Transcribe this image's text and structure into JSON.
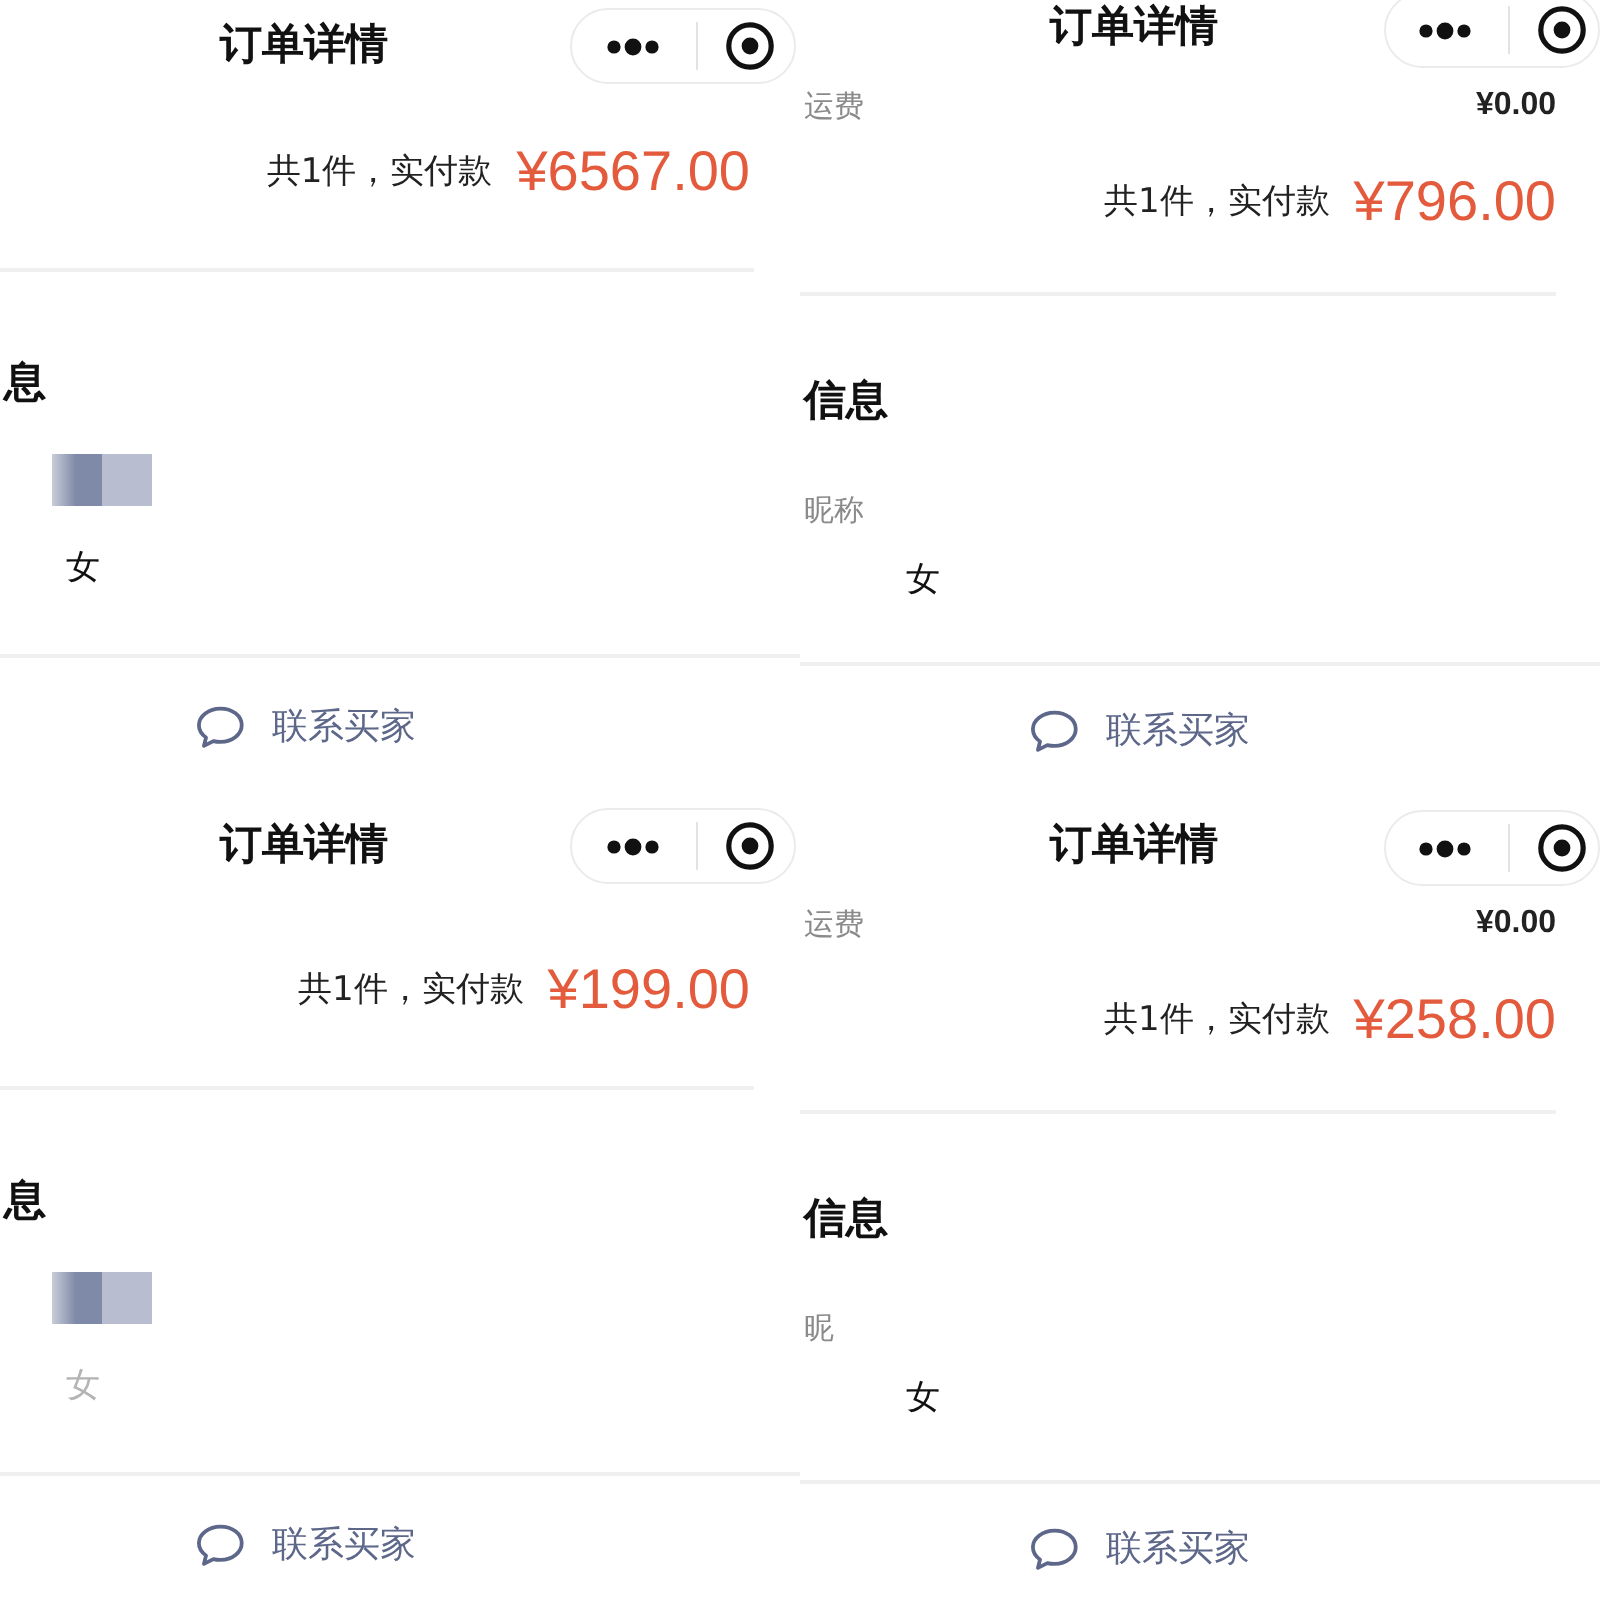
{
  "panels": [
    {
      "title": "订单详情",
      "summary": {
        "count": "共1件，实付款",
        "amount": "¥6567.00"
      },
      "buyer_section": {
        "heading": "息",
        "mosaic": true,
        "gender": {
          "value": "女",
          "faded": false
        }
      },
      "contact_button": "联系买家"
    },
    {
      "title": "订单详情",
      "shipping": {
        "label": "运费",
        "value": "¥0.00"
      },
      "summary": {
        "count": "共1件，实付款",
        "amount": "¥796.00"
      },
      "buyer_section": {
        "heading": "信息",
        "nickname_label": "昵称",
        "gender": {
          "value": "女",
          "faded": false
        }
      },
      "contact_button": "联系买家"
    },
    {
      "title": "订单详情",
      "summary": {
        "count": "共1件，实付款",
        "amount": "¥199.00"
      },
      "buyer_section": {
        "heading": "息",
        "mosaic": true,
        "gender": {
          "value": "女",
          "faded": true
        }
      },
      "contact_button": "联系买家"
    },
    {
      "title": "订单详情",
      "shipping": {
        "label": "运费",
        "value": "¥0.00"
      },
      "summary": {
        "count": "共1件，实付款",
        "amount": "¥258.00"
      },
      "buyer_section": {
        "heading": "信息",
        "nickname_label": "昵",
        "gender": {
          "value": "女",
          "faded": false
        }
      },
      "contact_button": "联系买家"
    }
  ]
}
